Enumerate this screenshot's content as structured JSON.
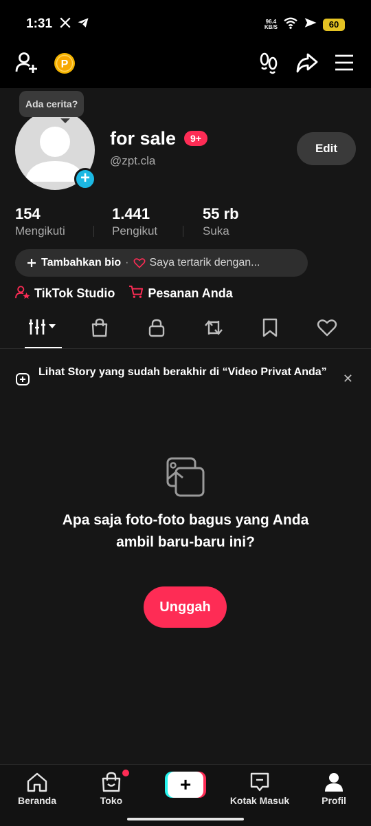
{
  "status_bar": {
    "time": "1:31",
    "net_speed": "96.4",
    "net_unit": "KB/S",
    "battery": "60",
    "icons": [
      "x-icon",
      "telegram-icon",
      "wifi-icon",
      "airplane-icon",
      "battery-icon"
    ]
  },
  "top_bar": {
    "icons": [
      "add-friend-icon",
      "coin-icon",
      "footprints-icon",
      "share-icon",
      "menu-icon"
    ],
    "coin_letter": "P"
  },
  "profile": {
    "story_tooltip": "Ada cerita?",
    "username": "for sale",
    "notif_badge": "9+",
    "handle": "@zpt.cla",
    "edit_label": "Edit"
  },
  "stats": [
    {
      "value": "154",
      "label": "Mengikuti"
    },
    {
      "value": "1.441",
      "label": "Pengikut"
    },
    {
      "value": "55 rb",
      "label": "Suka"
    }
  ],
  "bio": {
    "add_bio": "Tambahkan bio",
    "separator": "·",
    "interest": "Saya tertarik dengan..."
  },
  "quick_links": {
    "studio": "TikTok Studio",
    "orders": "Pesanan Anda"
  },
  "tabs": [
    "videos-grid-icon",
    "shop-icon",
    "lock-icon",
    "repost-icon",
    "bookmark-icon",
    "heart-icon"
  ],
  "banner": {
    "text": "Lihat Story yang sudah berakhir di “Video Privat Anda”"
  },
  "empty_state": {
    "message": "Apa saja foto-foto bagus yang Anda ambil baru-baru ini?",
    "upload_label": "Unggah"
  },
  "bottom_nav": {
    "home": "Beranda",
    "shop": "Toko",
    "create": "+",
    "inbox": "Kotak Masuk",
    "profile": "Profil"
  },
  "colors": {
    "accent": "#fe2c55",
    "background": "#161616",
    "avatar_add": "#1cb8e3",
    "coin": "#f5b400"
  }
}
